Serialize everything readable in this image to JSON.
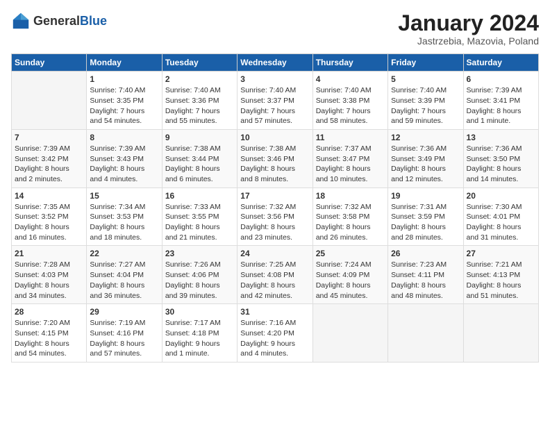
{
  "header": {
    "logo_general": "General",
    "logo_blue": "Blue",
    "title": "January 2024",
    "subtitle": "Jastrzebia, Mazovia, Poland"
  },
  "weekdays": [
    "Sunday",
    "Monday",
    "Tuesday",
    "Wednesday",
    "Thursday",
    "Friday",
    "Saturday"
  ],
  "weeks": [
    [
      {
        "day": "",
        "content": ""
      },
      {
        "day": "1",
        "content": "Sunrise: 7:40 AM\nSunset: 3:35 PM\nDaylight: 7 hours\nand 54 minutes."
      },
      {
        "day": "2",
        "content": "Sunrise: 7:40 AM\nSunset: 3:36 PM\nDaylight: 7 hours\nand 55 minutes."
      },
      {
        "day": "3",
        "content": "Sunrise: 7:40 AM\nSunset: 3:37 PM\nDaylight: 7 hours\nand 57 minutes."
      },
      {
        "day": "4",
        "content": "Sunrise: 7:40 AM\nSunset: 3:38 PM\nDaylight: 7 hours\nand 58 minutes."
      },
      {
        "day": "5",
        "content": "Sunrise: 7:40 AM\nSunset: 3:39 PM\nDaylight: 7 hours\nand 59 minutes."
      },
      {
        "day": "6",
        "content": "Sunrise: 7:39 AM\nSunset: 3:41 PM\nDaylight: 8 hours\nand 1 minute."
      }
    ],
    [
      {
        "day": "7",
        "content": "Sunrise: 7:39 AM\nSunset: 3:42 PM\nDaylight: 8 hours\nand 2 minutes."
      },
      {
        "day": "8",
        "content": "Sunrise: 7:39 AM\nSunset: 3:43 PM\nDaylight: 8 hours\nand 4 minutes."
      },
      {
        "day": "9",
        "content": "Sunrise: 7:38 AM\nSunset: 3:44 PM\nDaylight: 8 hours\nand 6 minutes."
      },
      {
        "day": "10",
        "content": "Sunrise: 7:38 AM\nSunset: 3:46 PM\nDaylight: 8 hours\nand 8 minutes."
      },
      {
        "day": "11",
        "content": "Sunrise: 7:37 AM\nSunset: 3:47 PM\nDaylight: 8 hours\nand 10 minutes."
      },
      {
        "day": "12",
        "content": "Sunrise: 7:36 AM\nSunset: 3:49 PM\nDaylight: 8 hours\nand 12 minutes."
      },
      {
        "day": "13",
        "content": "Sunrise: 7:36 AM\nSunset: 3:50 PM\nDaylight: 8 hours\nand 14 minutes."
      }
    ],
    [
      {
        "day": "14",
        "content": "Sunrise: 7:35 AM\nSunset: 3:52 PM\nDaylight: 8 hours\nand 16 minutes."
      },
      {
        "day": "15",
        "content": "Sunrise: 7:34 AM\nSunset: 3:53 PM\nDaylight: 8 hours\nand 18 minutes."
      },
      {
        "day": "16",
        "content": "Sunrise: 7:33 AM\nSunset: 3:55 PM\nDaylight: 8 hours\nand 21 minutes."
      },
      {
        "day": "17",
        "content": "Sunrise: 7:32 AM\nSunset: 3:56 PM\nDaylight: 8 hours\nand 23 minutes."
      },
      {
        "day": "18",
        "content": "Sunrise: 7:32 AM\nSunset: 3:58 PM\nDaylight: 8 hours\nand 26 minutes."
      },
      {
        "day": "19",
        "content": "Sunrise: 7:31 AM\nSunset: 3:59 PM\nDaylight: 8 hours\nand 28 minutes."
      },
      {
        "day": "20",
        "content": "Sunrise: 7:30 AM\nSunset: 4:01 PM\nDaylight: 8 hours\nand 31 minutes."
      }
    ],
    [
      {
        "day": "21",
        "content": "Sunrise: 7:28 AM\nSunset: 4:03 PM\nDaylight: 8 hours\nand 34 minutes."
      },
      {
        "day": "22",
        "content": "Sunrise: 7:27 AM\nSunset: 4:04 PM\nDaylight: 8 hours\nand 36 minutes."
      },
      {
        "day": "23",
        "content": "Sunrise: 7:26 AM\nSunset: 4:06 PM\nDaylight: 8 hours\nand 39 minutes."
      },
      {
        "day": "24",
        "content": "Sunrise: 7:25 AM\nSunset: 4:08 PM\nDaylight: 8 hours\nand 42 minutes."
      },
      {
        "day": "25",
        "content": "Sunrise: 7:24 AM\nSunset: 4:09 PM\nDaylight: 8 hours\nand 45 minutes."
      },
      {
        "day": "26",
        "content": "Sunrise: 7:23 AM\nSunset: 4:11 PM\nDaylight: 8 hours\nand 48 minutes."
      },
      {
        "day": "27",
        "content": "Sunrise: 7:21 AM\nSunset: 4:13 PM\nDaylight: 8 hours\nand 51 minutes."
      }
    ],
    [
      {
        "day": "28",
        "content": "Sunrise: 7:20 AM\nSunset: 4:15 PM\nDaylight: 8 hours\nand 54 minutes."
      },
      {
        "day": "29",
        "content": "Sunrise: 7:19 AM\nSunset: 4:16 PM\nDaylight: 8 hours\nand 57 minutes."
      },
      {
        "day": "30",
        "content": "Sunrise: 7:17 AM\nSunset: 4:18 PM\nDaylight: 9 hours\nand 1 minute."
      },
      {
        "day": "31",
        "content": "Sunrise: 7:16 AM\nSunset: 4:20 PM\nDaylight: 9 hours\nand 4 minutes."
      },
      {
        "day": "",
        "content": ""
      },
      {
        "day": "",
        "content": ""
      },
      {
        "day": "",
        "content": ""
      }
    ]
  ]
}
